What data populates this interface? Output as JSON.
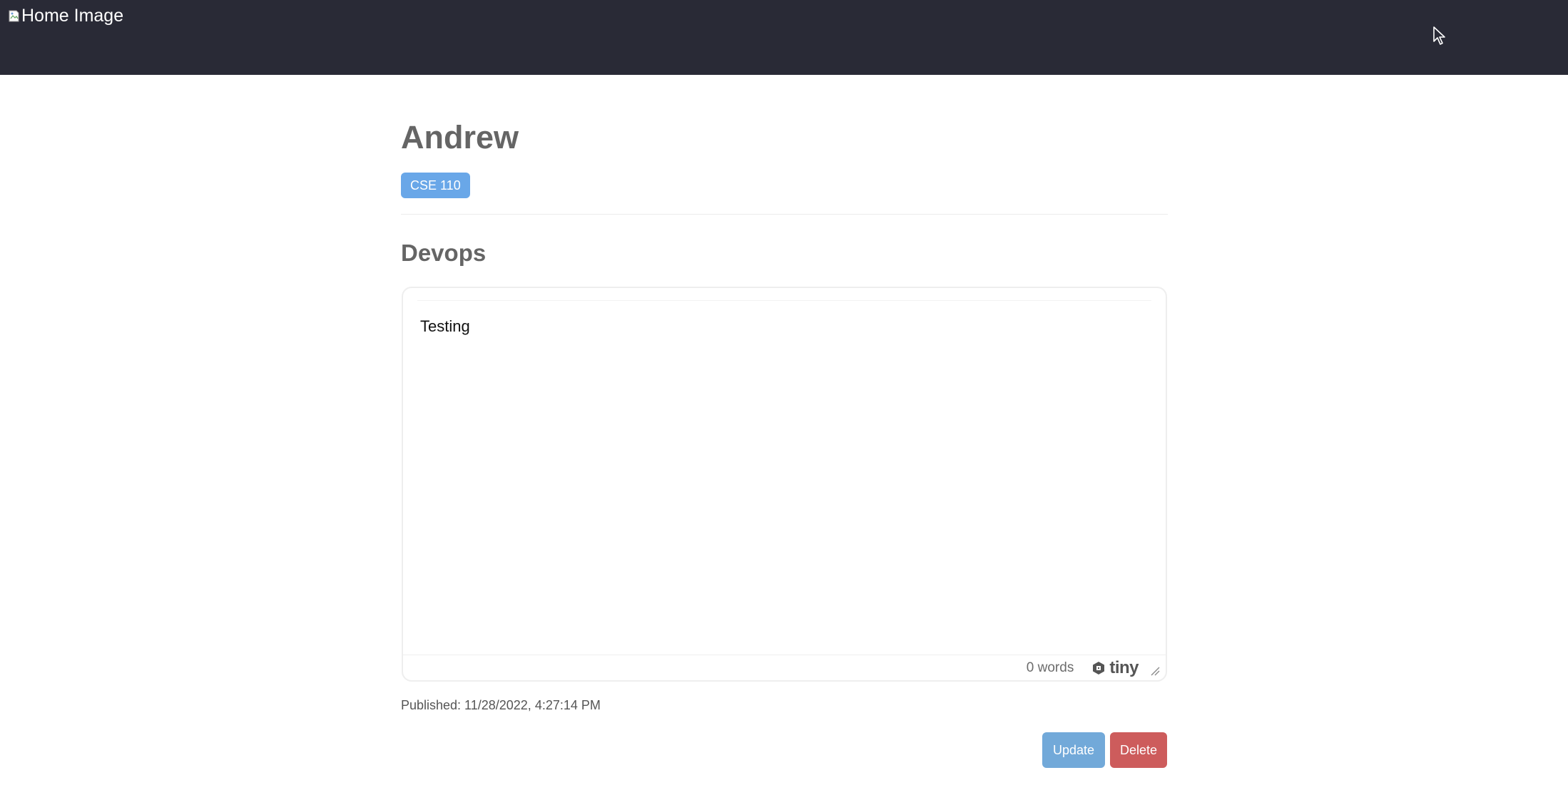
{
  "header": {
    "home_image_alt": "Home Image",
    "background_color": "#292a36"
  },
  "profile": {
    "name": "Andrew",
    "course_badge": "CSE 110",
    "badge_color": "#69a7e8"
  },
  "post": {
    "title": "Devops",
    "body": "Testing",
    "word_count": "0 words",
    "editor_brand": "tiny",
    "published": "Published: 11/28/2022, 4:27:14 PM"
  },
  "actions": {
    "update_label": "Update",
    "delete_label": "Delete",
    "update_color": "#72a9d9",
    "delete_color": "#cd5c5c"
  },
  "icons": {
    "broken_image": "broken-image-icon",
    "cursor": "cursor-arrow-icon",
    "tiny_logo": "tiny-logo-icon",
    "resize": "resize-handle-icon"
  }
}
